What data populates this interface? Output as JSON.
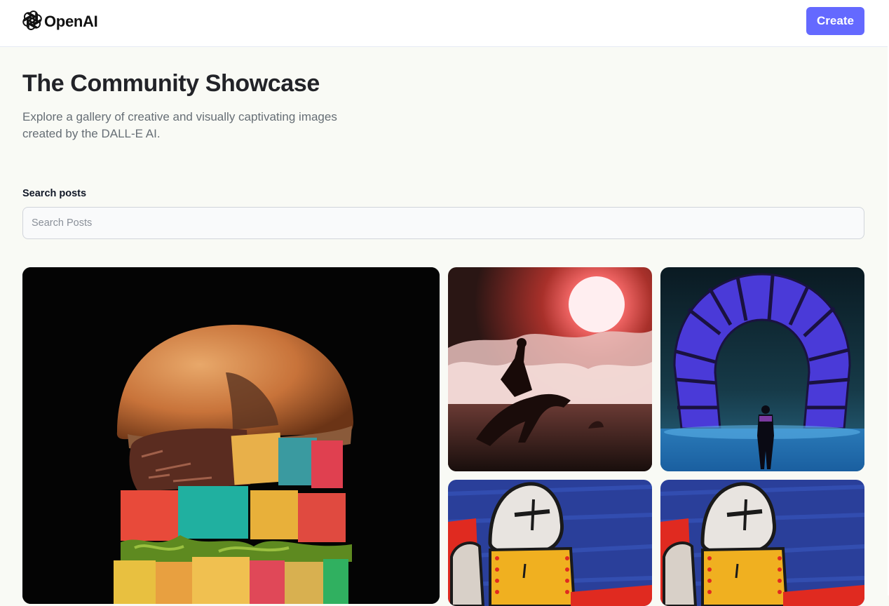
{
  "header": {
    "logo_text": "OpenAI",
    "logo_icon": "openai-logo-icon",
    "create_label": "Create"
  },
  "hero": {
    "title": "The Community Showcase",
    "subtitle": "Explore a gallery of creative and visually captivating images created by the DALL-E AI."
  },
  "search": {
    "label": "Search posts",
    "placeholder": "Search Posts",
    "value": ""
  },
  "gallery": {
    "items": [
      {
        "subject": "burger with colorful cube toppings"
      },
      {
        "subject": "rider on horse under red sun"
      },
      {
        "subject": "figure standing before a glowing portal"
      },
      {
        "subject": "painted robot figure"
      },
      {
        "subject": "painted robot figure"
      }
    ]
  },
  "colors": {
    "accent": "#6469ff",
    "page_bg": "#f9faf5",
    "title": "#222328",
    "subtitle": "#666e75"
  }
}
